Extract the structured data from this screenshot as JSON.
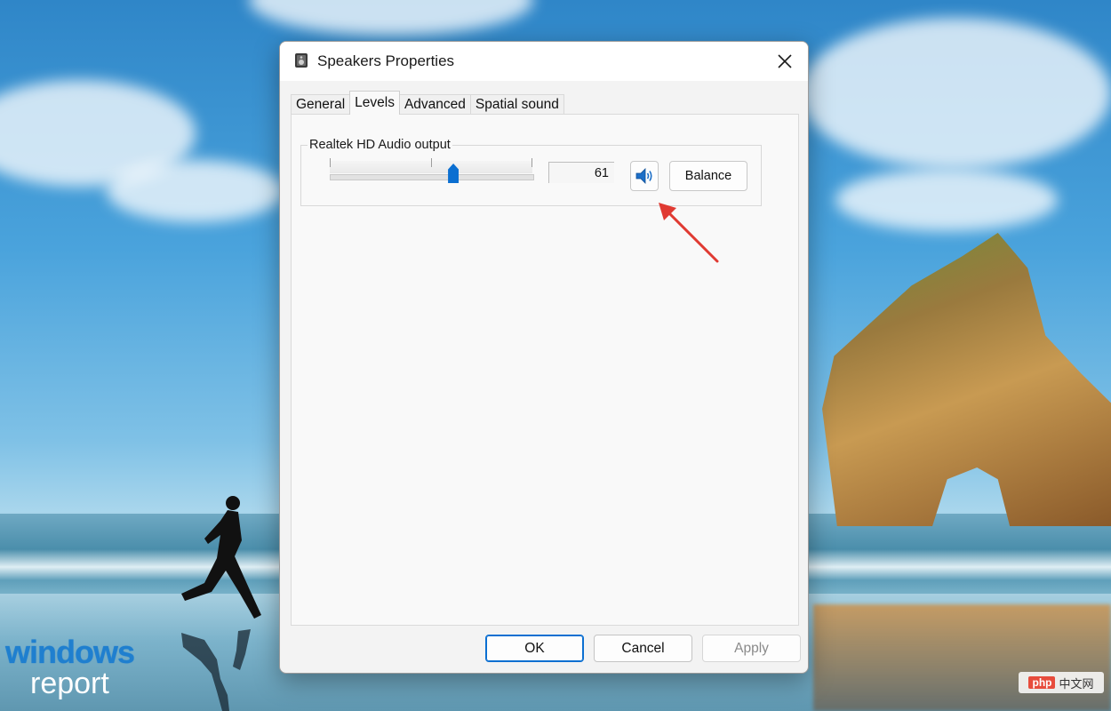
{
  "dialog": {
    "title": "Speakers Properties",
    "tabs": [
      {
        "label": "General",
        "active": false
      },
      {
        "label": "Levels",
        "active": true
      },
      {
        "label": "Advanced",
        "active": false
      },
      {
        "label": "Spatial sound",
        "active": false
      }
    ],
    "levels": {
      "device_label": "Realtek HD Audio output",
      "volume_value": "61",
      "volume_level": 61,
      "mute_icon": "speaker-icon",
      "balance_label": "Balance"
    },
    "buttons": {
      "ok": "OK",
      "cancel": "Cancel",
      "apply": "Apply"
    }
  },
  "watermark": {
    "brand_top": "windows",
    "brand_bottom": "report",
    "badge_php": "php",
    "badge_text": "中文网"
  },
  "colors": {
    "accent": "#0b6fd1",
    "annotation_arrow": "#e03a32"
  }
}
